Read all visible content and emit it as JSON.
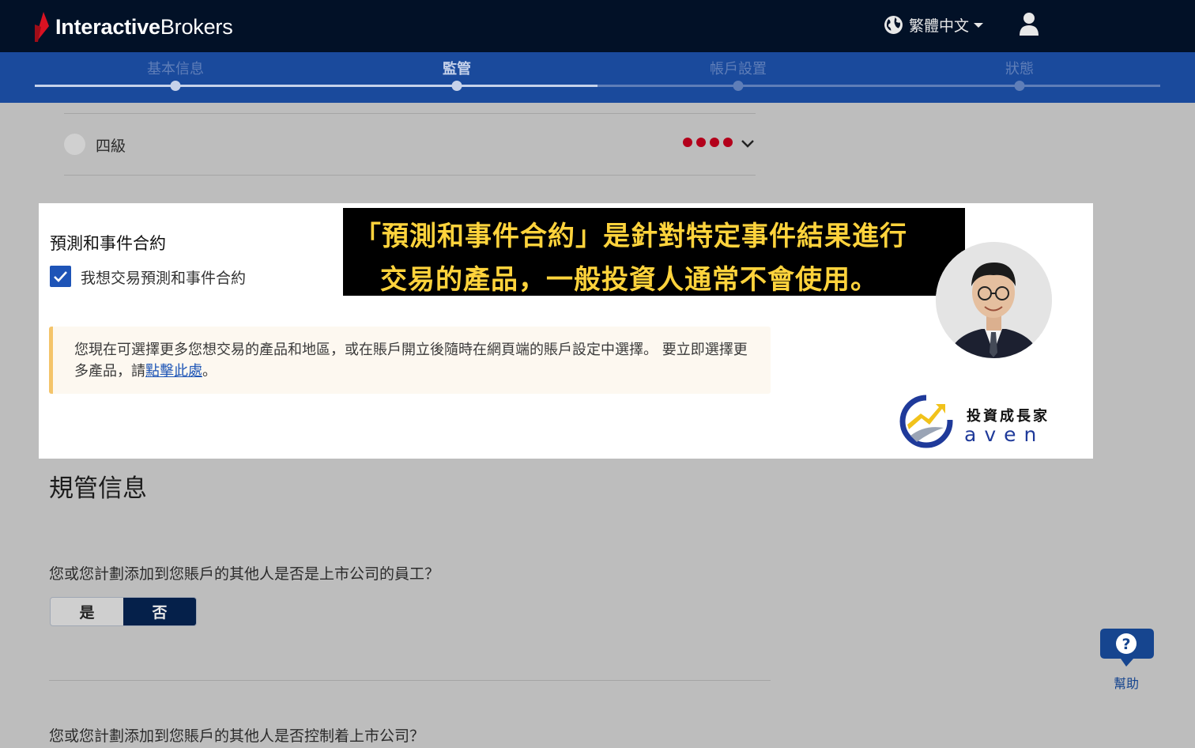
{
  "header": {
    "logo_bold": "Interactive",
    "logo_regular": "Brokers",
    "language": "繁體中文",
    "icons": [
      "logo-mark-icon",
      "globe-icon",
      "caret-down-icon",
      "user-icon"
    ]
  },
  "steps": [
    {
      "label": "基本信息",
      "state": "done"
    },
    {
      "label": "監管",
      "state": "current"
    },
    {
      "label": "帳戶設置",
      "state": "todo"
    },
    {
      "label": "狀態",
      "state": "todo"
    }
  ],
  "experience_row": {
    "label": "四級",
    "risk_level": 4,
    "risk_color": "#b3001b",
    "icons": [
      "radio-icon",
      "chevron-down-icon"
    ]
  },
  "product": {
    "title": "預測和事件合約",
    "checkbox_label": "我想交易預測和事件合約",
    "checked": true
  },
  "notice": {
    "text_before": "您現在可選擇更多您想交易的產品和地區，或在賬戶開立後隨時在網頁端的賬戶設定中選擇。 要立即選擇更多產品，請",
    "link": "點擊此處",
    "text_after": "。"
  },
  "caption": {
    "line1": "「預測和事件合約」是針對特定事件結果進行",
    "line2": "交易的產品，一般投資人通常不會使用。",
    "color": "#ffd33c"
  },
  "brand": {
    "title": "投資成長家",
    "subtitle": "aven"
  },
  "regulatory": {
    "title": "規管信息",
    "question1": "您或您計劃添加到您賬戶的其他人是否是上市公司的員工？",
    "yes_label": "是",
    "no_label": "否",
    "selected": "否",
    "question2": "您或您計劃添加到您賬戶的其他人是否控制着上市公司？"
  },
  "help": {
    "label": "幫助"
  },
  "colors": {
    "topbar": "#021127",
    "stepbar": "#1a4a9c",
    "accent_blue": "#1e54b7"
  }
}
